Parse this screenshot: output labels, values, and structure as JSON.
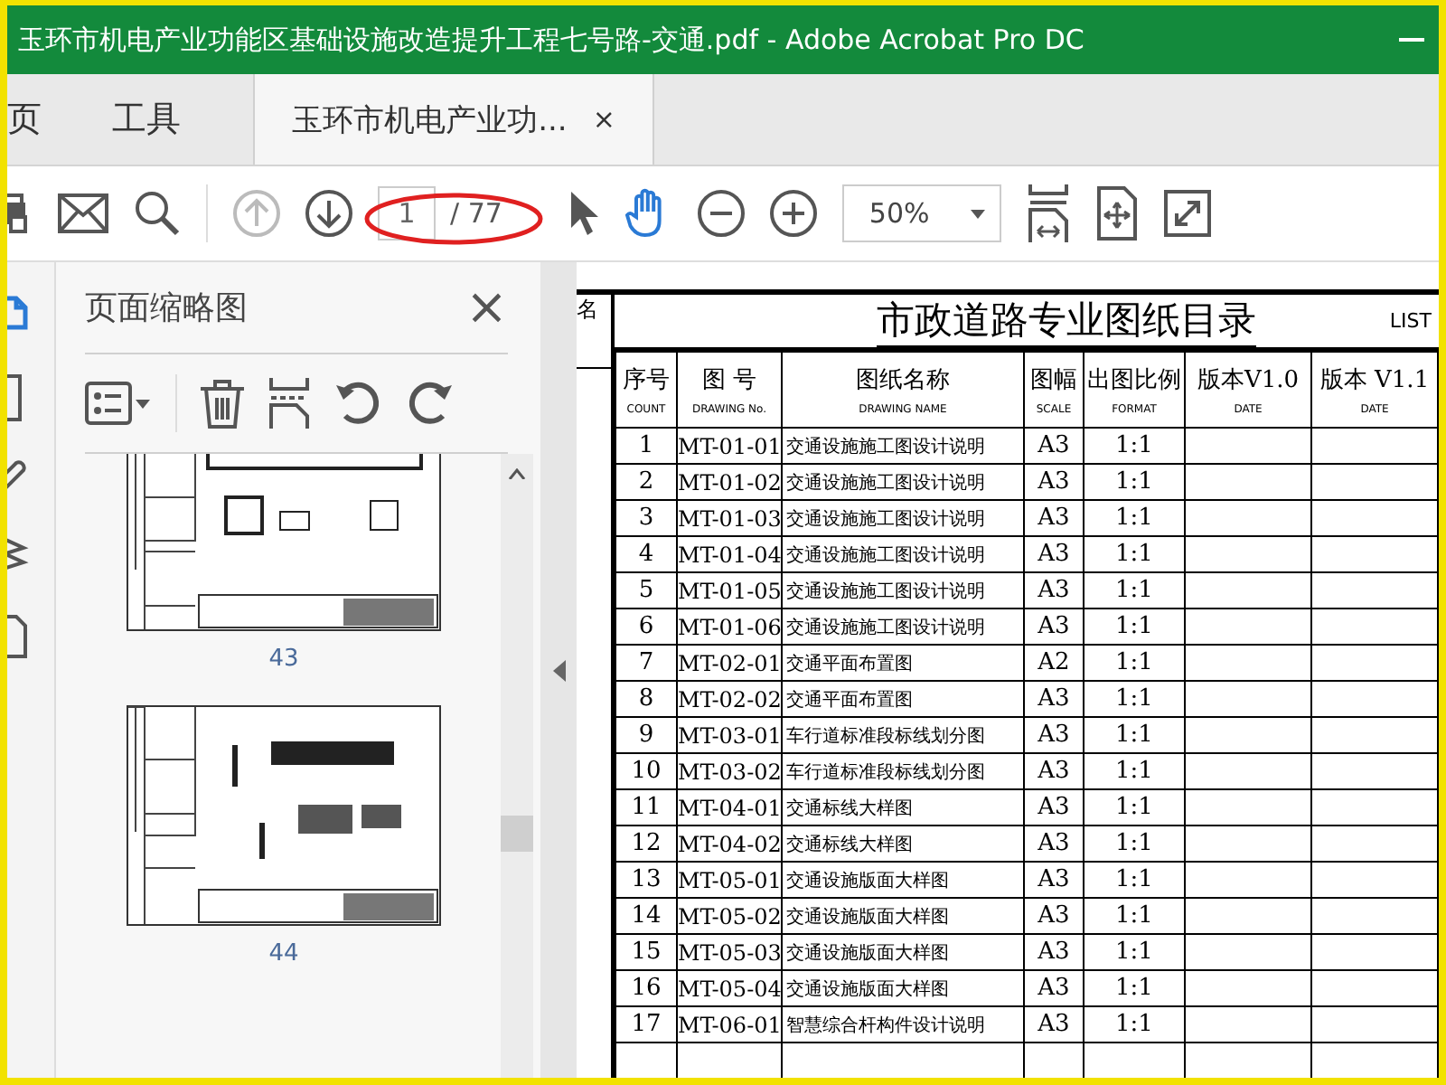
{
  "window": {
    "title": "玉环市机电产业功能区基础设施改造提升工程七号路-交通.pdf - Adobe Acrobat Pro DC"
  },
  "tabs": [
    {
      "label": "页",
      "kind": "home",
      "selected": false
    },
    {
      "label": "工具",
      "kind": "tools",
      "selected": false
    },
    {
      "label": "玉环市机电产业功...",
      "kind": "document",
      "selected": true,
      "close": "×"
    }
  ],
  "toolbar": {
    "nav": [
      {
        "kind": "prev",
        "disabled": true
      },
      {
        "kind": "next",
        "disabled": false
      }
    ],
    "page_field": {
      "value": "1"
    },
    "page_count": "/ 77",
    "tools": [
      {
        "kind": "pointer",
        "selected": false
      },
      {
        "kind": "hand",
        "selected": true
      }
    ],
    "zoom": {
      "value": "50%"
    }
  },
  "panel": {
    "title": "页面缩略图",
    "close": "×",
    "thumbnails": [
      {
        "label": "43",
        "kind": "clipped"
      },
      {
        "label": "44",
        "kind": "full"
      }
    ]
  },
  "document": {
    "side_label": "名",
    "title": "市政道路专业图纸目录",
    "title_en": "LIST",
    "columns": [
      {
        "zh": "序号",
        "en": "COUNT"
      },
      {
        "zh": "图 号",
        "en": "DRAWING No."
      },
      {
        "zh": "图纸名称",
        "en": "DRAWING NAME"
      },
      {
        "zh": "图幅",
        "en": "SCALE"
      },
      {
        "zh": "出图比例",
        "en": "FORMAT"
      },
      {
        "zh": "版本V1.0",
        "en": "DATE"
      },
      {
        "zh": "版本 V1.1",
        "en": "DATE"
      }
    ],
    "rows": [
      [
        "1",
        "MT-01-01",
        "交通设施施工图设计说明",
        "A3",
        "1:1"
      ],
      [
        "2",
        "MT-01-02",
        "交通设施施工图设计说明",
        "A3",
        "1:1"
      ],
      [
        "3",
        "MT-01-03",
        "交通设施施工图设计说明",
        "A3",
        "1:1"
      ],
      [
        "4",
        "MT-01-04",
        "交通设施施工图设计说明",
        "A3",
        "1:1"
      ],
      [
        "5",
        "MT-01-05",
        "交通设施施工图设计说明",
        "A3",
        "1:1"
      ],
      [
        "6",
        "MT-01-06",
        "交通设施施工图设计说明",
        "A3",
        "1:1"
      ],
      [
        "7",
        "MT-02-01",
        "交通平面布置图",
        "A2",
        "1:1"
      ],
      [
        "8",
        "MT-02-02",
        "交通平面布置图",
        "A3",
        "1:1"
      ],
      [
        "9",
        "MT-03-01",
        "车行道标准段标线划分图",
        "A3",
        "1:1"
      ],
      [
        "10",
        "MT-03-02",
        "车行道标准段标线划分图",
        "A3",
        "1:1"
      ],
      [
        "11",
        "MT-04-01",
        "交通标线大样图",
        "A3",
        "1:1"
      ],
      [
        "12",
        "MT-04-02",
        "交通标线大样图",
        "A3",
        "1:1"
      ],
      [
        "13",
        "MT-05-01",
        "交通设施版面大样图",
        "A3",
        "1:1"
      ],
      [
        "14",
        "MT-05-02",
        "交通设施版面大样图",
        "A3",
        "1:1"
      ],
      [
        "15",
        "MT-05-03",
        "交通设施版面大样图",
        "A3",
        "1:1"
      ],
      [
        "16",
        "MT-05-04",
        "交通设施版面大样图",
        "A3",
        "1:1"
      ],
      [
        "17",
        "MT-06-01",
        "智慧综合杆构件设计说明",
        "A3",
        "1:1"
      ]
    ]
  }
}
